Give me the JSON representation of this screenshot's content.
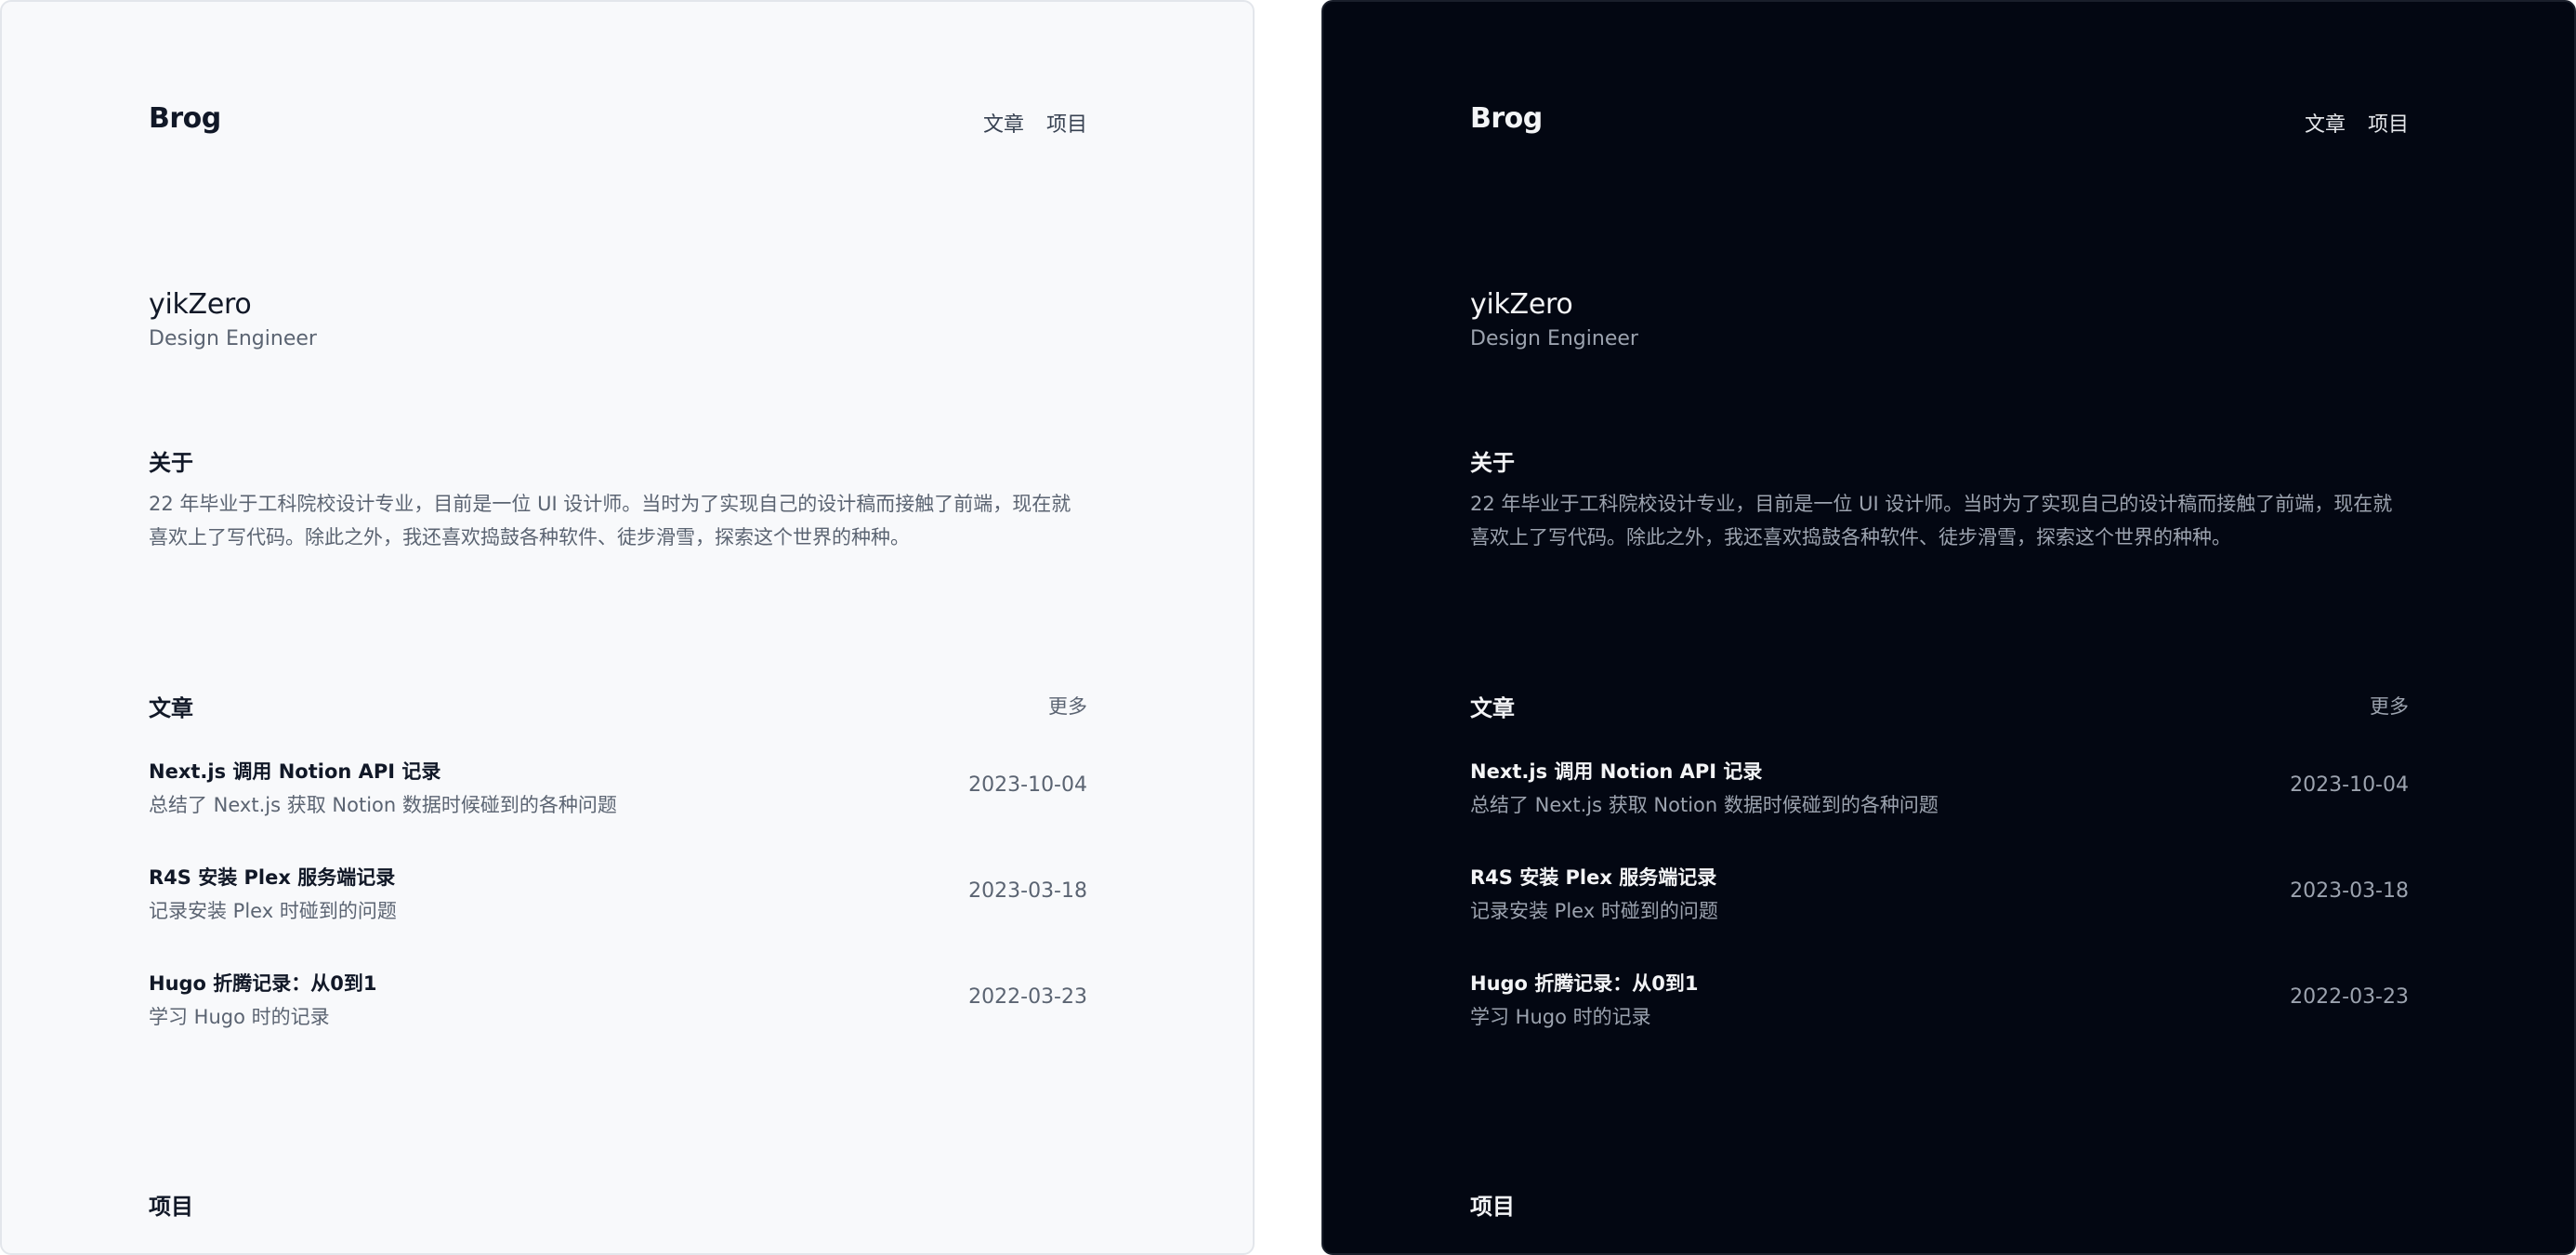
{
  "site": {
    "brand": "Brog",
    "nav": [
      "文章",
      "项目"
    ]
  },
  "profile": {
    "name": "yikZero",
    "role": "Design Engineer"
  },
  "about": {
    "title": "关于",
    "text": "22 年毕业于工科院校设计专业，目前是一位 UI 设计师。当时为了实现自己的设计稿而接触了前端，现在就喜欢上了写代码。除此之外，我还喜欢捣鼓各种软件、徒步滑雪，探索这个世界的种种。"
  },
  "articles": {
    "title": "文章",
    "more": "更多",
    "items": [
      {
        "title": "Next.js 调用 Notion API 记录",
        "desc": "总结了 Next.js 获取 Notion 数据时候碰到的各种问题",
        "date": "2023-10-04"
      },
      {
        "title": "R4S 安装 Plex 服务端记录",
        "desc": "记录安装 Plex 时碰到的问题",
        "date": "2023-03-18"
      },
      {
        "title": "Hugo 折腾记录：从0到1",
        "desc": "学习 Hugo 时的记录",
        "date": "2022-03-23"
      }
    ]
  },
  "projects": {
    "title": "项目"
  },
  "theme": {
    "light_bg": "#f8f9fb",
    "dark_bg": "#030712"
  }
}
